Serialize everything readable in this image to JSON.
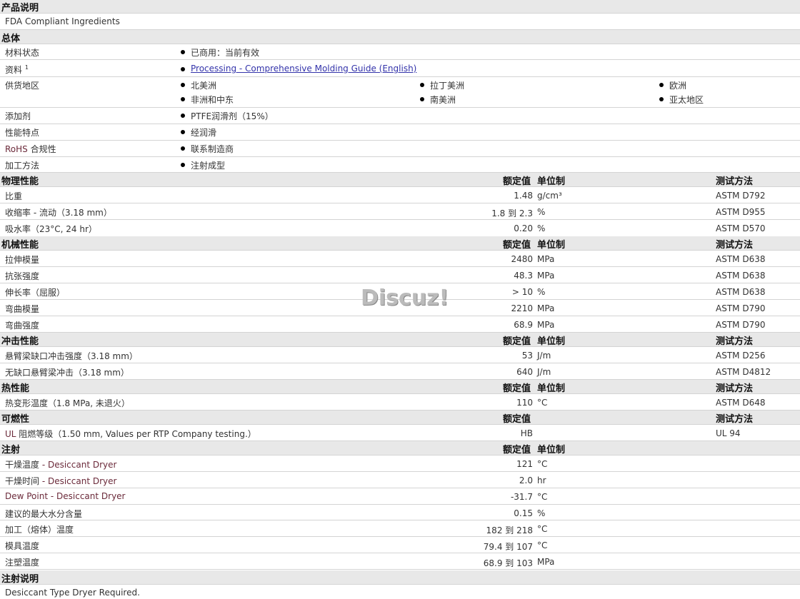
{
  "h_desc": "产品说明",
  "desc_text": "FDA Compliant Ingredients",
  "h_general": "总体",
  "general": {
    "material_status_label": "材料状态",
    "material_status": "已商用：当前有效",
    "docs_label": "资料",
    "docs_sup": "1",
    "docs_link": "Processing - Comprehensive Molding Guide (English)",
    "supply_label": "供货地区",
    "regions": [
      "北美洲",
      "拉丁美洲",
      "欧洲",
      "非洲和中东",
      "南美洲",
      "亚太地区"
    ],
    "additive_label": "添加剂",
    "additive": "PTFE润滑剂（15%）",
    "features_label": "性能特点",
    "features": "经润滑",
    "rohs_label_a": "RoHS",
    "rohs_label_b": " 合规性",
    "rohs": "联系制造商",
    "process_label": "加工方法",
    "process": "注射成型"
  },
  "col": {
    "value": "额定值",
    "unit": "单位制",
    "method": "测试方法"
  },
  "sections": {
    "physical": "物理性能",
    "mechanical": "机械性能",
    "impact": "冲击性能",
    "thermal": "热性能",
    "flammability": "可燃性",
    "injection": "注射",
    "injection_notes": "注射说明"
  },
  "physical_rows": [
    {
      "label": "比重",
      "value": "1.48",
      "unit": "g/cm³",
      "method": "ASTM D792"
    },
    {
      "label": "收缩率  - 流动（3.18 mm）",
      "value": "1.8 到  2.3",
      "unit": "%",
      "method": "ASTM D955"
    },
    {
      "label": "吸水率（23°C, 24 hr）",
      "value": "0.20",
      "unit": "%",
      "method": "ASTM D570"
    }
  ],
  "mechanical_rows": [
    {
      "label": "拉伸模量",
      "value": "2480",
      "unit": "MPa",
      "method": "ASTM D638"
    },
    {
      "label": "抗张强度",
      "value": "48.3",
      "unit": "MPa",
      "method": "ASTM D638"
    },
    {
      "label": "伸长率（屈服）",
      "value": "> 10",
      "unit": "%",
      "method": "ASTM D638"
    },
    {
      "label": "弯曲模量",
      "value": "2210",
      "unit": "MPa",
      "method": "ASTM D790"
    },
    {
      "label": "弯曲强度",
      "value": "68.9",
      "unit": "MPa",
      "method": "ASTM D790"
    }
  ],
  "impact_rows": [
    {
      "label": "悬臂梁缺口冲击强度（3.18 mm）",
      "value": "53",
      "unit": "J/m",
      "method": "ASTM D256"
    },
    {
      "label": "无缺口悬臂梁冲击（3.18 mm）",
      "value": "640",
      "unit": "J/m",
      "method": "ASTM D4812"
    }
  ],
  "thermal_rows": [
    {
      "label": "热变形温度（1.8 MPa, 未退火）",
      "value": "110",
      "unit": "°C",
      "method": "ASTM D648"
    }
  ],
  "flam_rows": [
    {
      "label_a": "UL",
      "label_b": " 阻燃等级（1.50 mm, Values per RTP Company testing.）",
      "value": "HB",
      "method": "UL 94"
    }
  ],
  "injection_rows": [
    {
      "label": "干燥温度  - Desiccant Dryer",
      "value": "121",
      "unit": "°C"
    },
    {
      "label": "干燥时间  - Desiccant Dryer",
      "value": "2.0",
      "unit": "hr"
    },
    {
      "label": "Dew Point - Desiccant Dryer",
      "value": "-31.7",
      "unit": "°C"
    },
    {
      "label": "建议的最大水分含量",
      "value": "0.15",
      "unit": "%"
    },
    {
      "label": "加工（熔体）温度",
      "value": "182 到  218",
      "unit": "°C"
    },
    {
      "label": "模具温度",
      "value": "79.4 到  107",
      "unit": "°C"
    },
    {
      "label": "注塑温度",
      "value": "68.9 到  103",
      "unit": "MPa"
    }
  ],
  "notes_text": "Desiccant Type Dryer Required.",
  "watermark": "Discuz!"
}
